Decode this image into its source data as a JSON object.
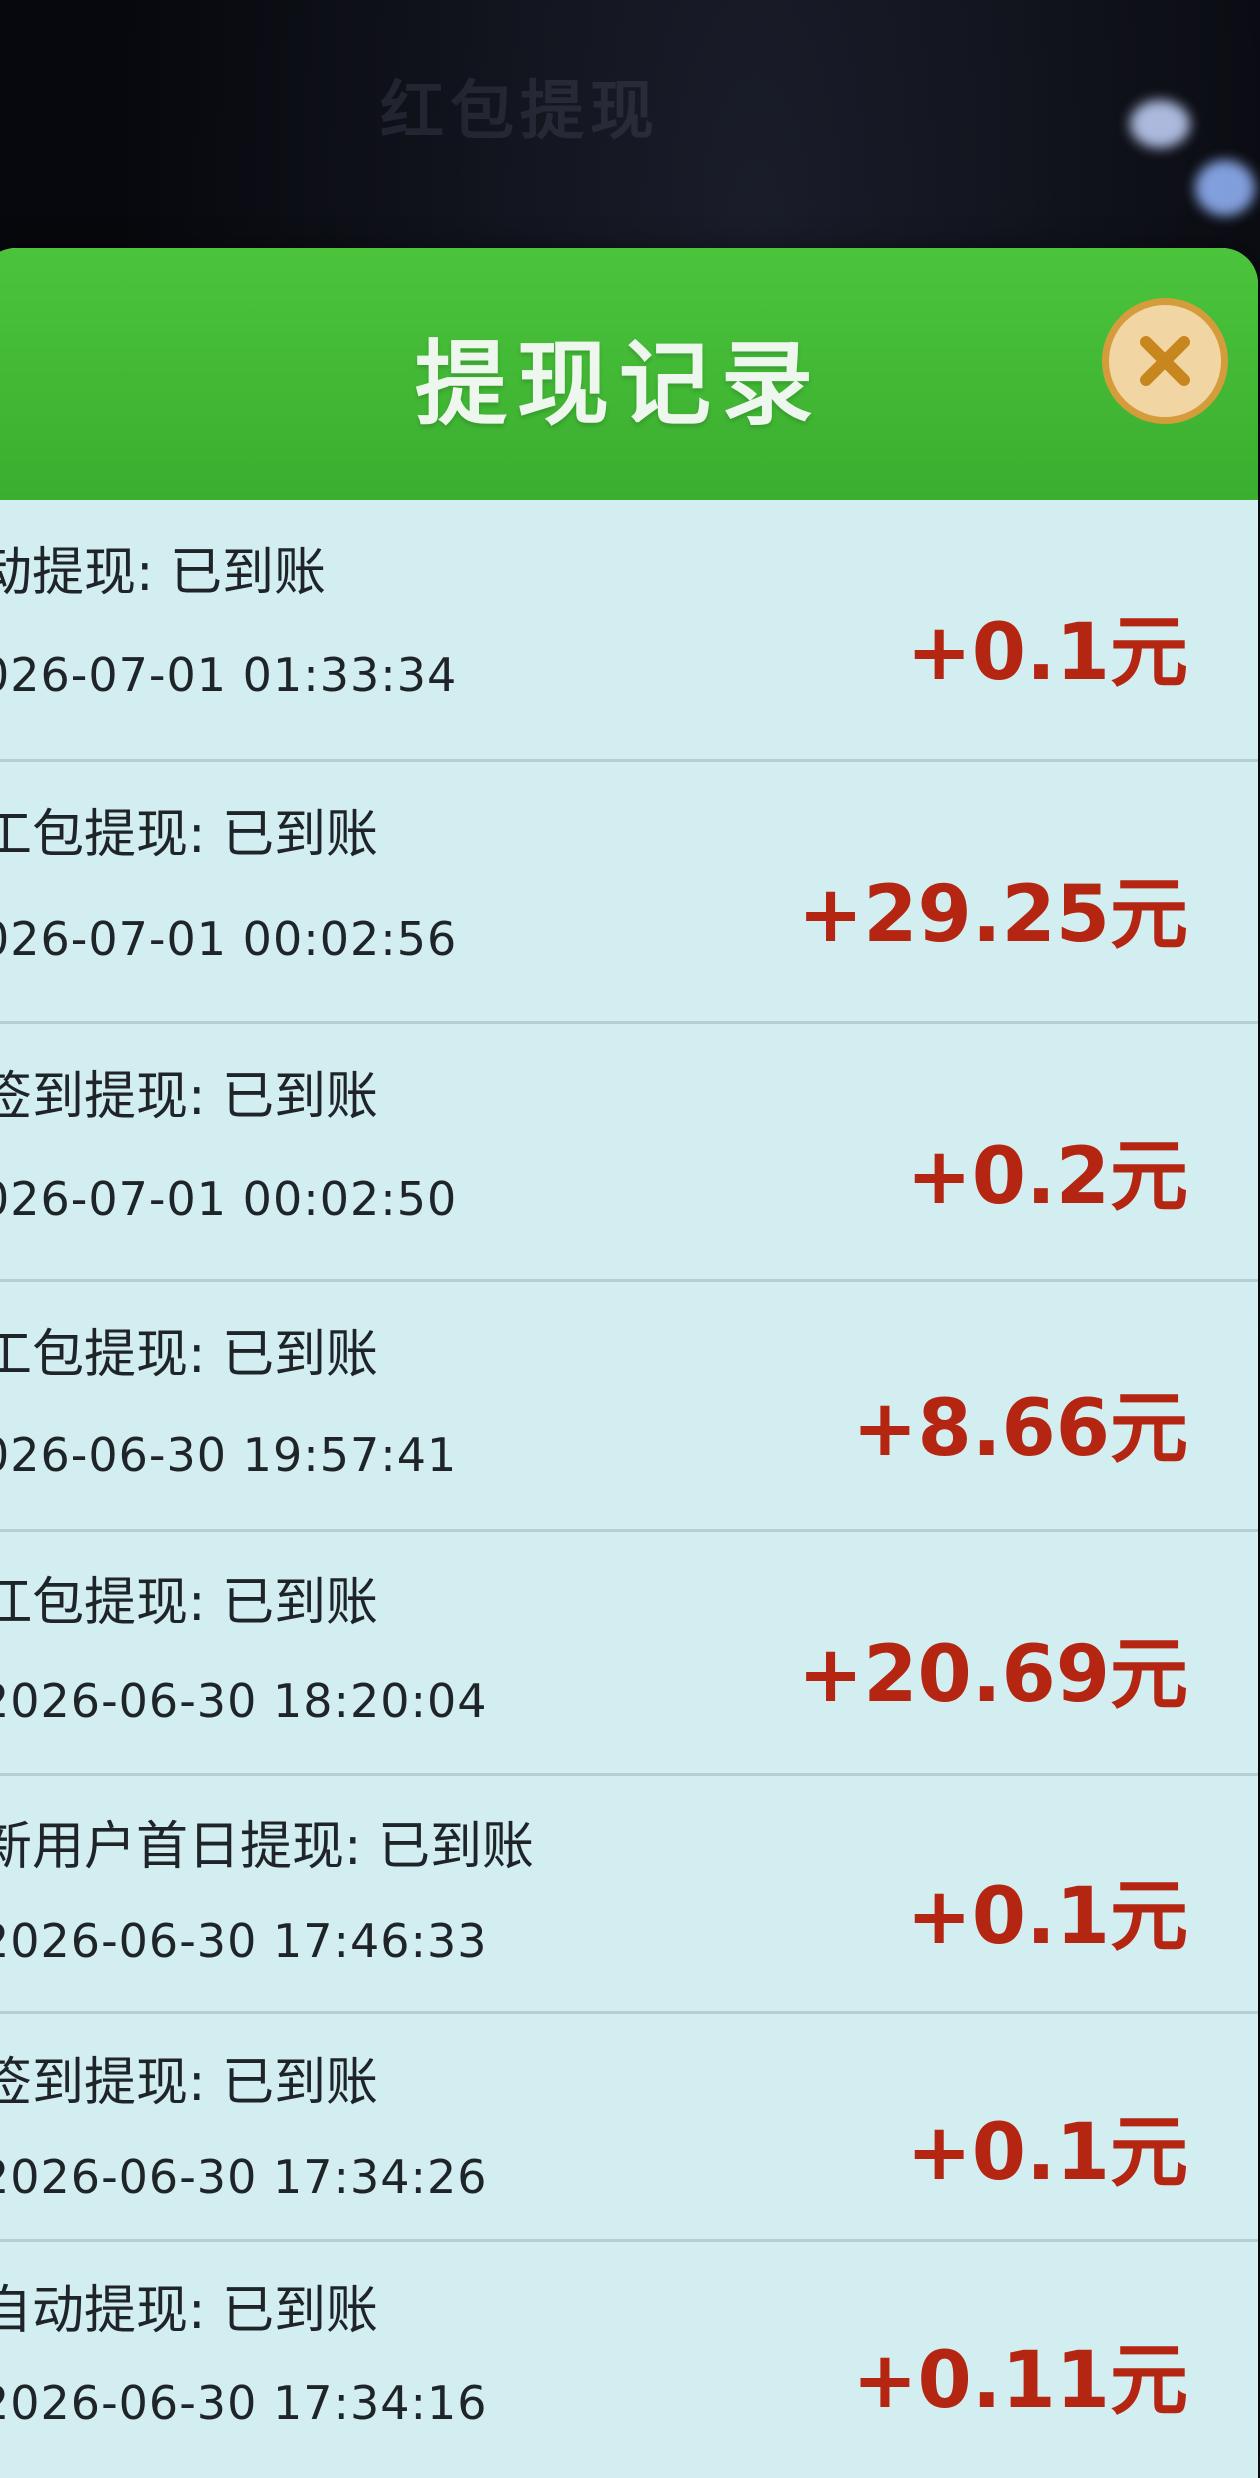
{
  "background_title": "红包提现",
  "dialog": {
    "title": "提现记录",
    "close_icon": "close-x-icon",
    "accent_color": "#3fb833",
    "amount_color": "#b52612"
  },
  "records": [
    {
      "label": "动提现: 已到账",
      "time": "026-07-01 01:33:34",
      "amount": "+0.1元"
    },
    {
      "label": "工包提现: 已到账",
      "time": "026-07-01 00:02:56",
      "amount": "+29.25元"
    },
    {
      "label": "签到提现: 已到账",
      "time": "026-07-01 00:02:50",
      "amount": "+0.2元"
    },
    {
      "label": "工包提现: 已到账",
      "time": "026-06-30 19:57:41",
      "amount": "+8.66元"
    },
    {
      "label": "江包提现: 已到账",
      "time": "2026-06-30 18:20:04",
      "amount": "+20.69元"
    },
    {
      "label": "新用户首日提现: 已到账",
      "time": "2026-06-30 17:46:33",
      "amount": "+0.1元"
    },
    {
      "label": "签到提现: 已到账",
      "time": "2026-06-30 17:34:26",
      "amount": "+0.1元"
    },
    {
      "label": "自动提现: 已到账",
      "time": "2026-06-30 17:34:16",
      "amount": "+0.11元"
    }
  ]
}
